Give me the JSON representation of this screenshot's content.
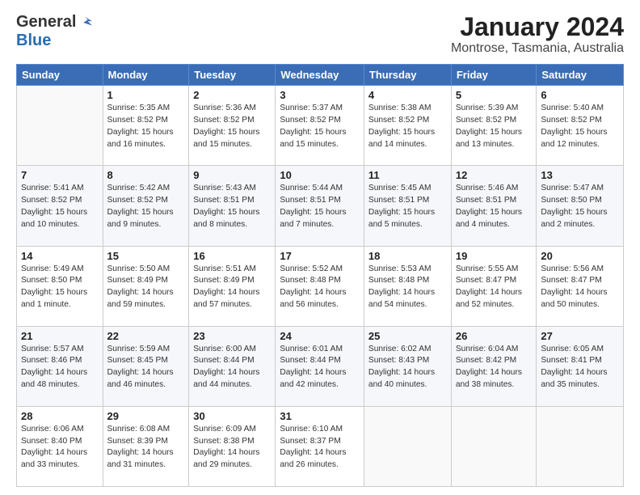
{
  "logo": {
    "general": "General",
    "blue": "Blue"
  },
  "title": "January 2024",
  "location": "Montrose, Tasmania, Australia",
  "days_of_week": [
    "Sunday",
    "Monday",
    "Tuesday",
    "Wednesday",
    "Thursday",
    "Friday",
    "Saturday"
  ],
  "weeks": [
    [
      {
        "day": "",
        "sunrise": "",
        "sunset": "",
        "daylight": ""
      },
      {
        "day": "1",
        "sunrise": "Sunrise: 5:35 AM",
        "sunset": "Sunset: 8:52 PM",
        "daylight": "Daylight: 15 hours and 16 minutes."
      },
      {
        "day": "2",
        "sunrise": "Sunrise: 5:36 AM",
        "sunset": "Sunset: 8:52 PM",
        "daylight": "Daylight: 15 hours and 15 minutes."
      },
      {
        "day": "3",
        "sunrise": "Sunrise: 5:37 AM",
        "sunset": "Sunset: 8:52 PM",
        "daylight": "Daylight: 15 hours and 15 minutes."
      },
      {
        "day": "4",
        "sunrise": "Sunrise: 5:38 AM",
        "sunset": "Sunset: 8:52 PM",
        "daylight": "Daylight: 15 hours and 14 minutes."
      },
      {
        "day": "5",
        "sunrise": "Sunrise: 5:39 AM",
        "sunset": "Sunset: 8:52 PM",
        "daylight": "Daylight: 15 hours and 13 minutes."
      },
      {
        "day": "6",
        "sunrise": "Sunrise: 5:40 AM",
        "sunset": "Sunset: 8:52 PM",
        "daylight": "Daylight: 15 hours and 12 minutes."
      }
    ],
    [
      {
        "day": "7",
        "sunrise": "Sunrise: 5:41 AM",
        "sunset": "Sunset: 8:52 PM",
        "daylight": "Daylight: 15 hours and 10 minutes."
      },
      {
        "day": "8",
        "sunrise": "Sunrise: 5:42 AM",
        "sunset": "Sunset: 8:52 PM",
        "daylight": "Daylight: 15 hours and 9 minutes."
      },
      {
        "day": "9",
        "sunrise": "Sunrise: 5:43 AM",
        "sunset": "Sunset: 8:51 PM",
        "daylight": "Daylight: 15 hours and 8 minutes."
      },
      {
        "day": "10",
        "sunrise": "Sunrise: 5:44 AM",
        "sunset": "Sunset: 8:51 PM",
        "daylight": "Daylight: 15 hours and 7 minutes."
      },
      {
        "day": "11",
        "sunrise": "Sunrise: 5:45 AM",
        "sunset": "Sunset: 8:51 PM",
        "daylight": "Daylight: 15 hours and 5 minutes."
      },
      {
        "day": "12",
        "sunrise": "Sunrise: 5:46 AM",
        "sunset": "Sunset: 8:51 PM",
        "daylight": "Daylight: 15 hours and 4 minutes."
      },
      {
        "day": "13",
        "sunrise": "Sunrise: 5:47 AM",
        "sunset": "Sunset: 8:50 PM",
        "daylight": "Daylight: 15 hours and 2 minutes."
      }
    ],
    [
      {
        "day": "14",
        "sunrise": "Sunrise: 5:49 AM",
        "sunset": "Sunset: 8:50 PM",
        "daylight": "Daylight: 15 hours and 1 minute."
      },
      {
        "day": "15",
        "sunrise": "Sunrise: 5:50 AM",
        "sunset": "Sunset: 8:49 PM",
        "daylight": "Daylight: 14 hours and 59 minutes."
      },
      {
        "day": "16",
        "sunrise": "Sunrise: 5:51 AM",
        "sunset": "Sunset: 8:49 PM",
        "daylight": "Daylight: 14 hours and 57 minutes."
      },
      {
        "day": "17",
        "sunrise": "Sunrise: 5:52 AM",
        "sunset": "Sunset: 8:48 PM",
        "daylight": "Daylight: 14 hours and 56 minutes."
      },
      {
        "day": "18",
        "sunrise": "Sunrise: 5:53 AM",
        "sunset": "Sunset: 8:48 PM",
        "daylight": "Daylight: 14 hours and 54 minutes."
      },
      {
        "day": "19",
        "sunrise": "Sunrise: 5:55 AM",
        "sunset": "Sunset: 8:47 PM",
        "daylight": "Daylight: 14 hours and 52 minutes."
      },
      {
        "day": "20",
        "sunrise": "Sunrise: 5:56 AM",
        "sunset": "Sunset: 8:47 PM",
        "daylight": "Daylight: 14 hours and 50 minutes."
      }
    ],
    [
      {
        "day": "21",
        "sunrise": "Sunrise: 5:57 AM",
        "sunset": "Sunset: 8:46 PM",
        "daylight": "Daylight: 14 hours and 48 minutes."
      },
      {
        "day": "22",
        "sunrise": "Sunrise: 5:59 AM",
        "sunset": "Sunset: 8:45 PM",
        "daylight": "Daylight: 14 hours and 46 minutes."
      },
      {
        "day": "23",
        "sunrise": "Sunrise: 6:00 AM",
        "sunset": "Sunset: 8:44 PM",
        "daylight": "Daylight: 14 hours and 44 minutes."
      },
      {
        "day": "24",
        "sunrise": "Sunrise: 6:01 AM",
        "sunset": "Sunset: 8:44 PM",
        "daylight": "Daylight: 14 hours and 42 minutes."
      },
      {
        "day": "25",
        "sunrise": "Sunrise: 6:02 AM",
        "sunset": "Sunset: 8:43 PM",
        "daylight": "Daylight: 14 hours and 40 minutes."
      },
      {
        "day": "26",
        "sunrise": "Sunrise: 6:04 AM",
        "sunset": "Sunset: 8:42 PM",
        "daylight": "Daylight: 14 hours and 38 minutes."
      },
      {
        "day": "27",
        "sunrise": "Sunrise: 6:05 AM",
        "sunset": "Sunset: 8:41 PM",
        "daylight": "Daylight: 14 hours and 35 minutes."
      }
    ],
    [
      {
        "day": "28",
        "sunrise": "Sunrise: 6:06 AM",
        "sunset": "Sunset: 8:40 PM",
        "daylight": "Daylight: 14 hours and 33 minutes."
      },
      {
        "day": "29",
        "sunrise": "Sunrise: 6:08 AM",
        "sunset": "Sunset: 8:39 PM",
        "daylight": "Daylight: 14 hours and 31 minutes."
      },
      {
        "day": "30",
        "sunrise": "Sunrise: 6:09 AM",
        "sunset": "Sunset: 8:38 PM",
        "daylight": "Daylight: 14 hours and 29 minutes."
      },
      {
        "day": "31",
        "sunrise": "Sunrise: 6:10 AM",
        "sunset": "Sunset: 8:37 PM",
        "daylight": "Daylight: 14 hours and 26 minutes."
      },
      {
        "day": "",
        "sunrise": "",
        "sunset": "",
        "daylight": ""
      },
      {
        "day": "",
        "sunrise": "",
        "sunset": "",
        "daylight": ""
      },
      {
        "day": "",
        "sunrise": "",
        "sunset": "",
        "daylight": ""
      }
    ]
  ]
}
